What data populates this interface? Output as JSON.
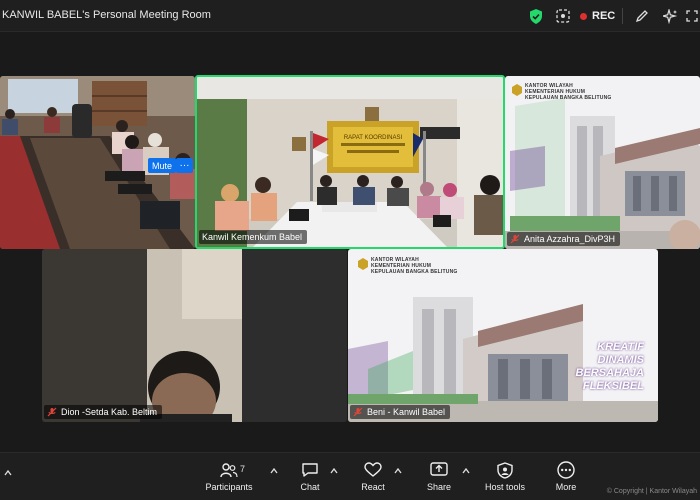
{
  "window": {
    "title": "KANWIL BABEL's Personal Meeting Room",
    "rec_label": "REC"
  },
  "tiles": {
    "top_left": {
      "mute_label": "Mute",
      "more_label": "···"
    },
    "top_center": {
      "name": "Kanwil Kemenkum Babel",
      "wall_banner": "RAPAT KOORDINASI"
    },
    "top_right": {
      "name": "Anita Azzahra_DivP3H",
      "org_lines": [
        "KANTOR WILAYAH",
        "KEMENTERIAN HUKUM",
        "KEPULAUAN BANGKA BELITUNG"
      ]
    },
    "bottom_left": {
      "name": "Dion -Setda Kab. Beltim"
    },
    "bottom_right": {
      "name": "Beni - Kanwil Babel",
      "org_lines": [
        "KANTOR WILAYAH",
        "KEMENTERIAN HUKUM",
        "KEPULAUAN BANGKA BELITUNG"
      ],
      "tagline": [
        "KREATIF",
        "DINAMIS",
        "BERSAHAJA",
        "FLEKSIBEL"
      ]
    }
  },
  "toolbar": {
    "participants_label": "Participants",
    "participants_count": "7",
    "chat_label": "Chat",
    "react_label": "React",
    "share_label": "Share",
    "host_tools_label": "Host tools",
    "more_label": "More",
    "copyright": "© Copyright | Kantor Wilayah"
  },
  "colors": {
    "active_speaker": "#23d96c",
    "mute_button": "#0e72ed",
    "rec_dot": "#e02f2f",
    "shield": "#23d96c",
    "mic_off": "#e0453a"
  }
}
